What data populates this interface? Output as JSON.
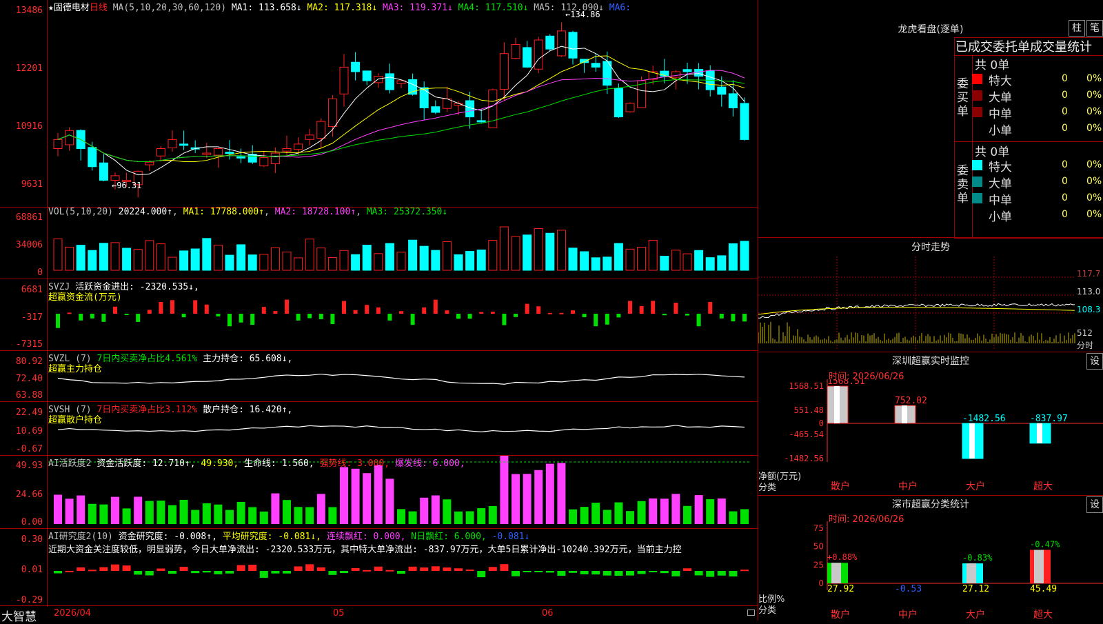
{
  "stock": {
    "name": "固德电材",
    "period": "日线",
    "star": "★"
  },
  "main": {
    "ma_label": "MA(5,10,20,30,60,120)",
    "ma1": "MA1: 113.658↓",
    "ma2": "MA2: 117.318↓",
    "ma3": "MA3: 119.371↓",
    "ma4": "MA4: 117.510↓",
    "ma5": "MA5: 112.090↓",
    "ma6": "MA6:",
    "y_ticks": [
      "13486",
      "12201",
      "10916",
      "9631"
    ],
    "high_label": "134.86",
    "low_label": "96.31"
  },
  "vol": {
    "title": "VOL(5,10,20)",
    "value": "20224.000↑",
    "ma1": "MA1: 17788.000↑",
    "ma2": "MA2: 18728.100↑",
    "ma3": "MA3: 25372.350↓",
    "y_ticks": [
      "68861",
      "34006",
      "0"
    ]
  },
  "svzj": {
    "title": "SVZJ",
    "desc": "活跃资金进出: -2320.535↓,",
    "sub": "超赢资金流(万元)",
    "y_ticks": [
      "6681",
      "-317",
      "-7315"
    ]
  },
  "svzl": {
    "title": "SVZL (7)",
    "desc": "7日内买卖净占比4.561%",
    "hold": "主力持仓: 65.608↓,",
    "sub": "超赢主力持仓",
    "y_ticks": [
      "80.92",
      "72.40",
      "63.88"
    ]
  },
  "svsh": {
    "title": "SVSH (7)",
    "desc": "7日内买卖净占比3.112%",
    "hold": "散户持仓: 16.420↑,",
    "sub": "超赢散户持仓",
    "y_ticks": [
      "22.49",
      "10.69",
      "-0.67"
    ]
  },
  "ai1": {
    "title": "AI活跃度2",
    "a": "资金活跃度: 12.710↑,",
    "b": "49.930,",
    "c": "生命线: 1.560,",
    "d": "强势线: 3.000,",
    "e": "爆发线: 6.000,",
    "y_ticks": [
      "49.93",
      "24.66",
      "0.00"
    ]
  },
  "ai2": {
    "title": "AI研究度2(10)",
    "a": "资金研究度: -0.008↑,",
    "b": "平均研究度: -0.081↓,",
    "c": "连续飘红: 0.000,",
    "d": "N日飘红: 6.000,",
    "e": "-0.081↓",
    "note": "近期大资金关注度较低，明显弱势，今日大单净流出: -2320.533万元，其中特大单净流出: -837.97万元，大单5日累计净出-10240.392万元，当前主力控",
    "y_ticks": [
      "0.30",
      "0.01",
      "-0.29"
    ]
  },
  "xaxis": {
    "start": "2026/04",
    "m5": "05",
    "m6": "06"
  },
  "brand": "大智慧",
  "right": {
    "lhb_title": "龙虎看盘(逐单)",
    "btn_zhu": "柱",
    "btn_bi": "笔",
    "table_title": "已成交委托单成交量统计",
    "buy_label": "委买单",
    "sell_label": "委卖单",
    "buy_total": "共 0单",
    "sell_total": "共 0单",
    "rows": [
      {
        "name": "特大",
        "count": "0",
        "pct": "0%"
      },
      {
        "name": "大单",
        "count": "0",
        "pct": "0%"
      },
      {
        "name": "中单",
        "count": "0",
        "pct": "0%"
      },
      {
        "name": "小单",
        "count": "0",
        "pct": "0%"
      }
    ],
    "colors": {
      "buy": [
        "#ff0000",
        "#8b0000",
        "#8b0000"
      ],
      "sell": [
        "#00ffff",
        "#008b8b",
        "#008b8b"
      ]
    },
    "fs_title": "分时走势",
    "fs_ticks": [
      "117.7",
      "113.0",
      "108.3",
      "512",
      "分时"
    ],
    "sz_title": "深圳超赢实时监控",
    "sz_set": "设",
    "sz_time": "时间: 2026/06/26",
    "sz_ticks": [
      "1568.51",
      "551.48",
      "0",
      "-465.54",
      "-1482.56"
    ],
    "sz_values": {
      "sanhu": "1568.51",
      "zhonghu": "752.02",
      "dahu": "-1482.56",
      "chaoda": "-837.97"
    },
    "sz_ylab": "净额(万元)",
    "sz_xlab": "分类",
    "cats": [
      "散户",
      "中户",
      "大户",
      "超大"
    ],
    "sc_title": "深市超赢分类统计",
    "sc_set": "设",
    "sc_time": "时间: 2026/06/26",
    "sc_ticks": [
      "75",
      "50",
      "25",
      "0"
    ],
    "sc_top": [
      "+0.88%",
      "-0.83%",
      "-0.47%"
    ],
    "sc_bottom": [
      "27.92",
      "-0.53",
      "27.12",
      "45.49"
    ],
    "sc_ylab": "比例%",
    "sc_xlab": "分类"
  },
  "chart_data": {
    "type": "bar",
    "title": "深圳超赢实时监控",
    "categories": [
      "散户",
      "中户",
      "大户",
      "超大"
    ],
    "values": [
      1568.51,
      752.02,
      -1482.56,
      -837.97
    ],
    "ylabel": "净额(万元)",
    "ylim": [
      -1482.56,
      1568.51
    ]
  }
}
